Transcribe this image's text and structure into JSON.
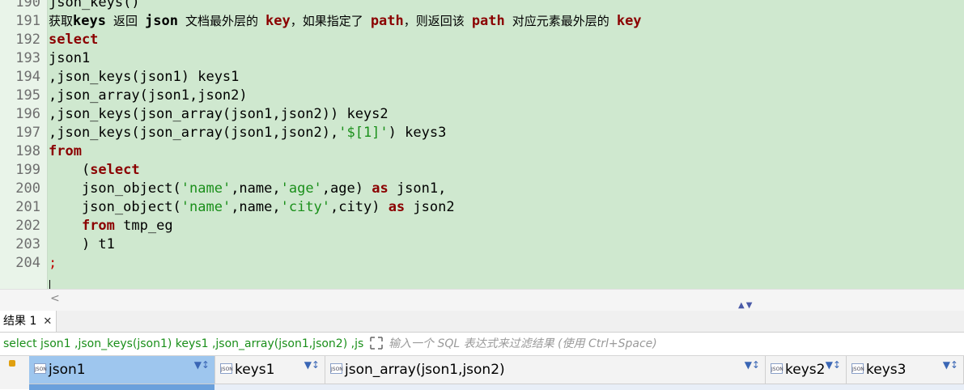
{
  "editor": {
    "lines": [
      {
        "n": "190",
        "tokens": [
          {
            "t": "json_keys()",
            "c": "code"
          }
        ]
      },
      {
        "n": "191",
        "tokens": [
          {
            "t": "获取",
            "c": "cmt"
          },
          {
            "t": "keys",
            "c": "cmtb"
          },
          {
            "t": " 返回 ",
            "c": "cmt"
          },
          {
            "t": "json",
            "c": "cmtb"
          },
          {
            "t": " 文档最外层的 ",
            "c": "cmt"
          },
          {
            "t": "key",
            "c": "kwc"
          },
          {
            "t": "，如果指定了 ",
            "c": "cmt"
          },
          {
            "t": "path",
            "c": "kwc"
          },
          {
            "t": "，则返回该 ",
            "c": "cmt"
          },
          {
            "t": "path",
            "c": "kwc"
          },
          {
            "t": " 对应元素最外层的 ",
            "c": "cmt"
          },
          {
            "t": "key",
            "c": "kwc"
          }
        ]
      },
      {
        "n": "192",
        "tokens": [
          {
            "t": "select",
            "c": "kw"
          }
        ]
      },
      {
        "n": "193",
        "tokens": [
          {
            "t": "json1",
            "c": "code"
          }
        ]
      },
      {
        "n": "194",
        "tokens": [
          {
            "t": ",json_keys(json1) keys1",
            "c": "code"
          }
        ]
      },
      {
        "n": "195",
        "tokens": [
          {
            "t": ",json_array(json1,json2)",
            "c": "code"
          }
        ]
      },
      {
        "n": "196",
        "tokens": [
          {
            "t": ",json_keys(json_array(json1,json2)) keys2",
            "c": "code"
          }
        ]
      },
      {
        "n": "197",
        "tokens": [
          {
            "t": ",json_keys(json_array(json1,json2),",
            "c": "code"
          },
          {
            "t": "'$[1]'",
            "c": "str"
          },
          {
            "t": ") keys3",
            "c": "code"
          }
        ]
      },
      {
        "n": "198",
        "tokens": [
          {
            "t": "from",
            "c": "kw"
          }
        ]
      },
      {
        "n": "199",
        "tokens": [
          {
            "t": "    (",
            "c": "code"
          },
          {
            "t": "select",
            "c": "kw"
          }
        ]
      },
      {
        "n": "200",
        "tokens": [
          {
            "t": "    json_object(",
            "c": "code"
          },
          {
            "t": "'name'",
            "c": "str"
          },
          {
            "t": ",name,",
            "c": "code"
          },
          {
            "t": "'age'",
            "c": "str"
          },
          {
            "t": ",age) ",
            "c": "code"
          },
          {
            "t": "as",
            "c": "kw"
          },
          {
            "t": " json1,",
            "c": "code"
          }
        ]
      },
      {
        "n": "201",
        "tokens": [
          {
            "t": "    json_object(",
            "c": "code"
          },
          {
            "t": "'name'",
            "c": "str"
          },
          {
            "t": ",name,",
            "c": "code"
          },
          {
            "t": "'city'",
            "c": "str"
          },
          {
            "t": ",city) ",
            "c": "code"
          },
          {
            "t": "as",
            "c": "kw"
          },
          {
            "t": " json2",
            "c": "code"
          }
        ]
      },
      {
        "n": "202",
        "tokens": [
          {
            "t": "    ",
            "c": "code"
          },
          {
            "t": "from",
            "c": "kw"
          },
          {
            "t": " tmp_eg",
            "c": "code"
          }
        ]
      },
      {
        "n": "203",
        "tokens": [
          {
            "t": "    ) t1",
            "c": "code"
          }
        ]
      },
      {
        "n": "204",
        "tokens": [
          {
            "t": ";",
            "c": "semi"
          }
        ]
      }
    ]
  },
  "results_tab": {
    "label": "结果 1",
    "close": "✕"
  },
  "filter": {
    "query": "select json1 ,json_keys(json1) keys1 ,json_array(json1,json2) ,js",
    "placeholder": "输入一个 SQL 表达式来过滤结果 (使用 Ctrl+Space)"
  },
  "grid": {
    "columns": [
      {
        "name": "json1",
        "type_icon": "JSON",
        "selected": true
      },
      {
        "name": "keys1",
        "type_icon": "JSON",
        "selected": false
      },
      {
        "name": "json_array(json1,json2)",
        "type_icon": "JSON",
        "selected": false
      },
      {
        "name": "keys2",
        "type_icon": "JSON",
        "selected": false
      },
      {
        "name": "keys3",
        "type_icon": "JSON",
        "selected": false
      }
    ],
    "sort_glyph": "▼↕"
  },
  "colors": {
    "editor_bg": "#cfe8cf",
    "keyword": "#8b0000",
    "string": "#1a8f1a",
    "selected_col": "#9ec6ee"
  }
}
